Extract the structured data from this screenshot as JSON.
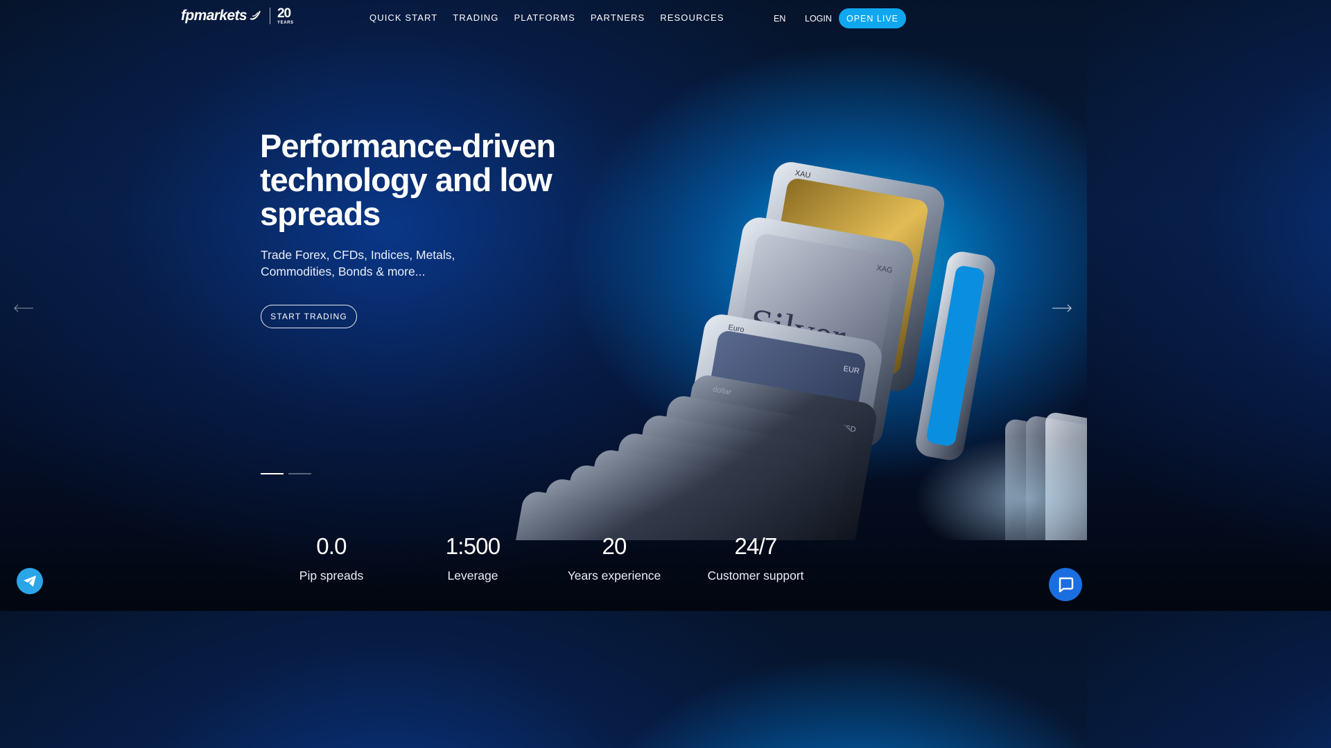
{
  "header": {
    "logo_text": "fpmarkets",
    "logo_years_number": "20",
    "logo_years_label": "YEARS",
    "nav": [
      {
        "label": "QUICK START"
      },
      {
        "label": "TRADING"
      },
      {
        "label": "PLATFORMS"
      },
      {
        "label": "PARTNERS"
      },
      {
        "label": "RESOURCES"
      }
    ],
    "language": "EN",
    "login_label": "LOGIN",
    "open_live_label": "OPEN LIVE"
  },
  "hero": {
    "title": "Performance-driven technology and low spreads",
    "subtitle": "Trade Forex, CFDs, Indices, Metals, Commodities, Bonds & more...",
    "cta_label": "START TRADING",
    "slides_total": 2,
    "active_slide": 1
  },
  "art_labels": {
    "gold": "XAU",
    "silver_code": "XAG",
    "silver_word": "Silver",
    "euro_word": "Euro",
    "euro_code": "EUR",
    "dollar_word": "dollar",
    "dollar_code": "USD"
  },
  "stats": [
    {
      "value": "0.0",
      "label": "Pip spreads"
    },
    {
      "value": "1:500",
      "label": "Leverage"
    },
    {
      "value": "20",
      "label": "Years experience"
    },
    {
      "value": "24/7",
      "label": "Customer support"
    }
  ],
  "icons": {
    "telegram": "telegram-icon",
    "chat": "chat-icon",
    "prev": "arrow-left-icon",
    "next": "arrow-right-icon"
  },
  "colors": {
    "accent": "#10a7ef",
    "background_dark": "#06142b",
    "glow": "#00aaf0",
    "chat_button": "#1a6ee0"
  }
}
